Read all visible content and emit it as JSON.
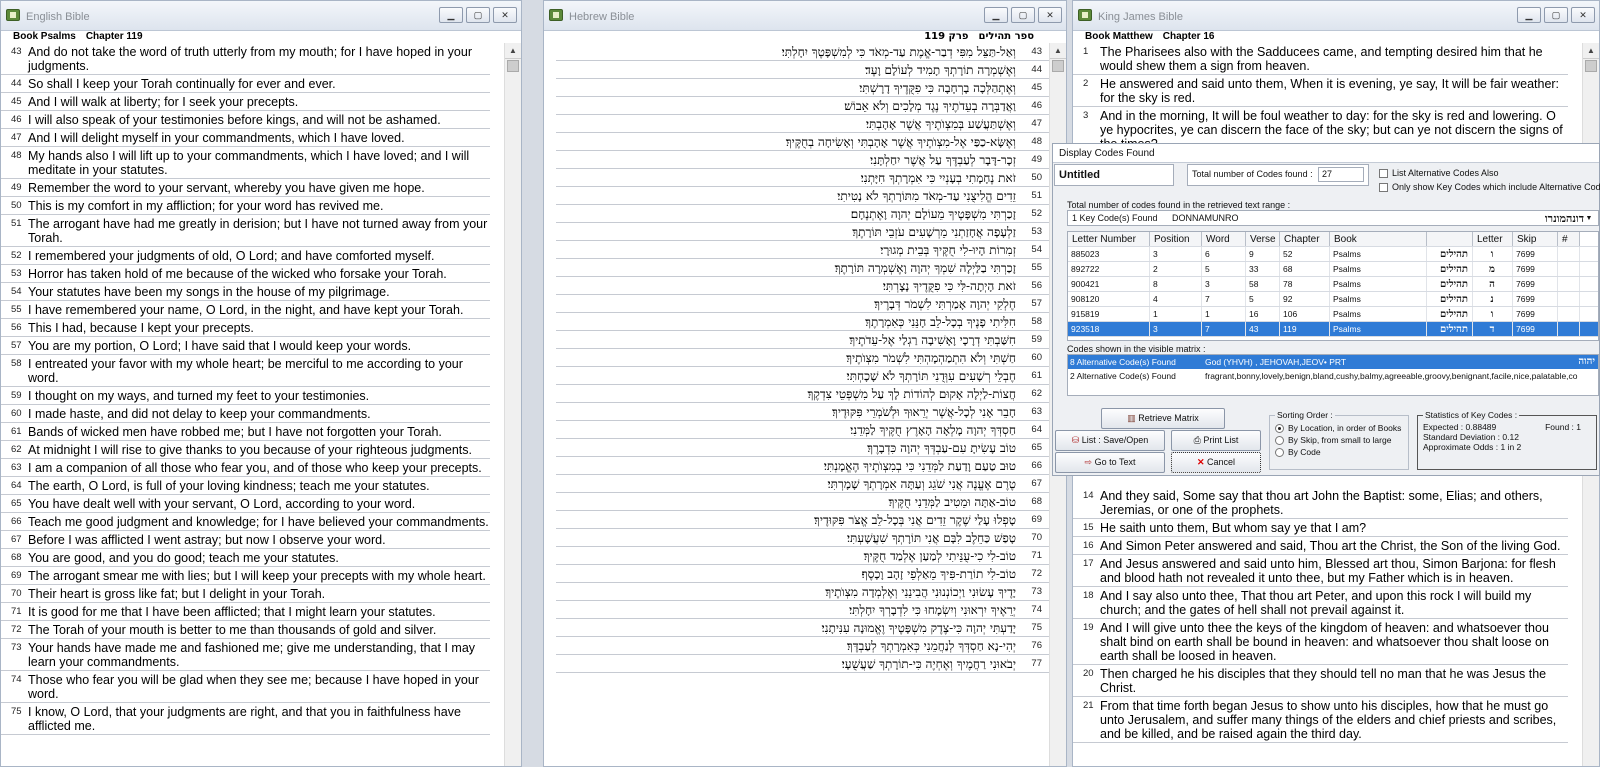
{
  "english": {
    "title": "English Bible",
    "book_label": "Book Psalms",
    "chapter_label": "Chapter 119",
    "rows": [
      {
        "n": "43",
        "t": "And do not take the word of truth utterly from my mouth; for I have hoped in your judgments."
      },
      {
        "n": "44",
        "t": "So shall I keep your Torah continually for ever and ever."
      },
      {
        "n": "45",
        "t": "And I will walk at liberty; for I seek your precepts."
      },
      {
        "n": "46",
        "t": "I will also speak of your testimonies before kings, and will not be ashamed."
      },
      {
        "n": "47",
        "t": "And I will delight myself in your commandments, which I have loved."
      },
      {
        "n": "48",
        "t": "My hands also I will lift up to your commandments, which I have loved; and I will meditate in your statutes."
      },
      {
        "n": "49",
        "t": "Remember the word to your servant, whereby you have given me hope."
      },
      {
        "n": "50",
        "t": "This is my comfort in my affliction; for your word has revived me."
      },
      {
        "n": "51",
        "t": "The arrogant have had me greatly in derision; but I have not turned away from your Torah."
      },
      {
        "n": "52",
        "t": "I remembered your judgments of old, O Lord; and have comforted myself."
      },
      {
        "n": "53",
        "t": "Horror has taken hold of me because of the wicked who forsake your Torah."
      },
      {
        "n": "54",
        "t": "Your statutes have been my songs in the house of my pilgrimage."
      },
      {
        "n": "55",
        "t": "I have remembered your name, O Lord, in the night, and have kept your Torah."
      },
      {
        "n": "56",
        "t": "This I had, because I kept your precepts."
      },
      {
        "n": "57",
        "t": "You are my portion, O Lord; I have said that I would keep your words."
      },
      {
        "n": "58",
        "t": "I entreated your favor with my whole heart; be merciful to me according to your word."
      },
      {
        "n": "59",
        "t": "I thought on my ways, and turned my feet to your testimonies."
      },
      {
        "n": "60",
        "t": "I made haste, and did not delay to keep your commandments."
      },
      {
        "n": "61",
        "t": "Bands of wicked men have robbed me; but I have not forgotten your Torah."
      },
      {
        "n": "62",
        "t": "At midnight I will rise to give thanks to you because of your righteous judgments."
      },
      {
        "n": "63",
        "t": "I am a companion of all those who fear you, and of those who keep your precepts."
      },
      {
        "n": "64",
        "t": "The earth, O Lord, is full of your loving kindness; teach me your statutes."
      },
      {
        "n": "65",
        "t": "You have dealt well with your servant, O Lord, according to your word."
      },
      {
        "n": "66",
        "t": "Teach me good judgment and knowledge; for I have believed your commandments."
      },
      {
        "n": "67",
        "t": "Before I was afflicted I went astray; but now I observe your word."
      },
      {
        "n": "68",
        "t": "You are good, and you do good; teach me your statutes."
      },
      {
        "n": "69",
        "t": "The arrogant smear me with lies; but I will keep your precepts with my whole heart."
      },
      {
        "n": "70",
        "t": "Their heart is gross like fat; but I delight in your Torah."
      },
      {
        "n": "71",
        "t": "It is good for me that I have been afflicted; that I might learn your statutes."
      },
      {
        "n": "72",
        "t": "The Torah of your mouth is better to me than thousands of gold and silver."
      },
      {
        "n": "73",
        "t": "Your hands have made me and fashioned me; give me understanding, that I may learn your commandments."
      },
      {
        "n": "74",
        "t": "Those who fear you will be glad when they see me; because I have hoped in your word."
      },
      {
        "n": "75",
        "t": "I know, O Lord, that your judgments are right, and that you in faithfulness have afflicted me."
      }
    ]
  },
  "hebrew": {
    "title": "Hebrew Bible",
    "book_label": "ספר תהילים",
    "chapter_label": "פרק 119",
    "rows": [
      {
        "n": "43",
        "t": "וְאַל-תַּצֵּל מִפִּי דְבַר-אֱמֶת עַד-מְאֹד כִּי לְמִשְׁפָּטֶךָ יִחָלְתִּי׃"
      },
      {
        "n": "44",
        "t": "וְאֶשְׁמְרָה תוֹרָתְךָ תָמִיד לְעוֹלָם וָעֶד׃"
      },
      {
        "n": "45",
        "t": "וְאֶתְהַלְּכָה בָרְחָבָה כִּי פִקֻּדֶיךָ דָרָשְׁתִּי׃"
      },
      {
        "n": "46",
        "t": "וַאֲדַבְּרָה בְעֵדֹתֶיךָ נֶגֶד מְלָכִים וְלֹא אֵבוֹשׁ׃"
      },
      {
        "n": "47",
        "t": "וְאֶשְׁתַּעֲשַׁע בְּמִצְוֺתֶיךָ אֲשֶׁר אָהָבְתִּי׃"
      },
      {
        "n": "48",
        "t": "וְאֶשָּׂא-כַפַּי אֶל-מִצְוֺתֶיךָ אֲשֶׁר אָהָבְתִּי וְאָשִׂיחָה בְחֻקֶּיךָ׃"
      },
      {
        "n": "49",
        "t": "זְכָר-דָּבָר לְעַבְדֶּךָ עַל אֲשֶׁר יִחַלְתָּנִי׃"
      },
      {
        "n": "50",
        "t": "זֹאת נֶחָמָתִי בְעָנְיִי כִּי אִמְרָתְךָ חִיָּתְנִי׃"
      },
      {
        "n": "51",
        "t": "זֵדִים הֱלִיצֻנִי עַד-מְאֹד מִתּוֹרָתְךָ לֹא נָטִיתִי׃"
      },
      {
        "n": "52",
        "t": "זָכַרְתִּי מִשְׁפָּטֶיךָ מֵעוֹלָם יְהוָה וָאֶתְנֶחָם׃"
      },
      {
        "n": "53",
        "t": "זַלְעָפָה אֲחָזַתְנִי מֵרְשָׁעִים עֹזְבֵי תּוֹרָתֶךָ׃"
      },
      {
        "n": "54",
        "t": "זְמִרוֹת הָיוּ-לִי חֻקֶּיךָ בְּבֵית מְגוּרָי׃"
      },
      {
        "n": "55",
        "t": "זָכַרְתִּי בַלַּיְלָה שִׁמְךָ יְהוָה וָאֶשְׁמְרָה תּוֹרָתֶךָ׃"
      },
      {
        "n": "56",
        "t": "זֹאת הָיְתָה-לִּי כִּי פִקֻּדֶיךָ נָצָרְתִּי׃"
      },
      {
        "n": "57",
        "t": "חֶלְקִי יְהוָה אָמַרְתִּי לִשְׁמֹר דְּבָרֶיךָ׃"
      },
      {
        "n": "58",
        "t": "חִלִּיתִי פָנֶיךָ בְכָל-לֵב חָנֵּנִי כְּאִמְרָתֶךָ׃"
      },
      {
        "n": "59",
        "t": "חִשַּׁבְתִּי דְרָכָי וָאָשִׁיבָה רַגְלַי אֶל-עֵדֹתֶיךָ׃"
      },
      {
        "n": "60",
        "t": "חַשְׁתִּי וְלֹא הִתְמַהְמָהְתִּי לִשְׁמֹר מִצְוֺתֶיךָ׃"
      },
      {
        "n": "61",
        "t": "חֶבְלֵי רְשָׁעִים עִוְּדֻנִי תּוֹרָתְךָ לֹא שָׁכָחְתִּי׃"
      },
      {
        "n": "62",
        "t": "חֲצוֹת-לַיְלָה אָקוּם לְהוֹדוֹת לָךְ עַל מִשְׁפְּטֵי צִדְקֶךָ׃"
      },
      {
        "n": "63",
        "t": "חָבֵר אָנִי לְכָל-אֲשֶׁר יְרֵאוּךָ וּלְשֹׁמְרֵי פִּקּוּדֶיךָ׃"
      },
      {
        "n": "64",
        "t": "חַסְדְּךָ יְהוָה מָלְאָה הָאָרֶץ חֻקֶּיךָ לַמְּדֵנִי׃"
      },
      {
        "n": "65",
        "t": "טוֹב עָשִׂיתָ עִם-עַבְדְּךָ יְהוָה כִּדְבָרֶךָ׃"
      },
      {
        "n": "66",
        "t": "טוּב טַעַם וָדַעַת לַמְּדֵנִי כִּי בְמִצְוֺתֶיךָ הֶאֱמָנְתִּי׃"
      },
      {
        "n": "67",
        "t": "טֶרֶם אֶעֱנֶה אֲנִי שֹׁגֵג וְעַתָּה אִמְרָתְךָ שָׁמָרְתִּי׃"
      },
      {
        "n": "68",
        "t": "טוֹב-אַתָּה וּמֵטִיב לַמְּדֵנִי חֻקֶּיךָ׃"
      },
      {
        "n": "69",
        "t": "טָפְלוּ עָלַי שֶׁקֶר זֵדִים אֲנִי בְּכָל-לֵב אֱצֹּר פִּקּוּדֶיךָ׃"
      },
      {
        "n": "70",
        "t": "טָפַשׁ כַּחֵלֶב לִבָּם אֲנִי תּוֹרָתְךָ שִׁעֲשָׁעְתִּי׃"
      },
      {
        "n": "71",
        "t": "טוֹב-לִי כִי-עֻנֵּיתִי לְמַעַן אֶלְמַד חֻקֶּיךָ׃"
      },
      {
        "n": "72",
        "t": "טוֹב-לִי תוֹרַת-פִּיךָ מֵאַלְפֵי זָהָב וָכָסֶף׃"
      },
      {
        "n": "73",
        "t": "יָדֶיךָ עָשׂוּנִי וַיְכוֹנְנוּנִי הֲבִינֵנִי וְאֶלְמְדָה מִצְוֺתֶיךָ׃"
      },
      {
        "n": "74",
        "t": "יְרֵאֶיךָ יִרְאוּנִי וְיִשְׂמָחוּ כִּי לִדְבָרְךָ יִחָלְתִּי׃"
      },
      {
        "n": "75",
        "t": "יָדַעְתִּי יְהוָה כִּי-צֶדֶק מִשְׁפָּטֶיךָ וֶאֱמוּנָה עִנִּיתָנִי׃"
      },
      {
        "n": "76",
        "t": "יְהִי-נָא חַסְדְּךָ לְנַחֲמֵנִי כְּאִמְרָתְךָ לְעַבְדֶּךָ׃"
      },
      {
        "n": "77",
        "t": "יְבֹאוּנִי רַחֲמֶיךָ וְאֶחְיֶה כִּי-תוֹרָתְךָ שַׁעֲשֻׁעָי׃"
      }
    ]
  },
  "kjv": {
    "title": "King James Bible",
    "book_label": "Book Matthew",
    "chapter_label": "Chapter 16",
    "rows_top": [
      {
        "n": "1",
        "t": "The Pharisees also with the Sadducees came, and tempting desired him that he would shew them a sign from heaven."
      },
      {
        "n": "2",
        "t": "He answered and said unto them, When it is evening, ye say, It will be fair weather: for the sky is red."
      },
      {
        "n": "3",
        "t": "And in the morning, It will be foul weather to day: for the sky is red and lowering. O ye hypocrites, ye can discern the face of the sky; but can ye not discern the signs of the times?"
      }
    ],
    "rows_bottom": [
      {
        "n": "14",
        "t": "And they said, Some say that thou art John the Baptist: some, Elias; and others, Jeremias, or one of the prophets."
      },
      {
        "n": "15",
        "t": "He saith unto them, But whom say ye that I am?"
      },
      {
        "n": "16",
        "t": "And Simon Peter answered and said, Thou art the Christ, the Son of the living God."
      },
      {
        "n": "17",
        "t": "And Jesus answered and said unto him, Blessed art thou, Simon Barjona: for flesh and blood hath not revealed it unto thee, but my Father which is in heaven."
      },
      {
        "n": "18",
        "t": "And I say also unto thee, That thou art Peter, and upon this rock I will build my church; and the gates of hell shall not prevail against it."
      },
      {
        "n": "19",
        "t": "And I will give unto thee the keys of the kingdom of heaven: and whatsoever thou shalt bind on earth shall be bound in heaven: and whatsoever thou shalt loose on earth shall be loosed in heaven."
      },
      {
        "n": "20",
        "t": "Then charged he his disciples that they should tell no man that he was Jesus the Christ."
      },
      {
        "n": "21",
        "t": "From that time forth began Jesus to show unto his disciples, how that he must go unto Jerusalem, and suffer many things of the elders and chief priests and scribes, and be killed, and be raised again the third day."
      }
    ]
  },
  "dialog": {
    "caption": "Display Codes Found",
    "name": "Untitled",
    "total_label": "Total number of Codes found :",
    "total_value": "27",
    "list_alt": "List Alternative Codes Also",
    "only_show": "Only show Key Codes which include Alternative Codes",
    "range_label": "Total number of codes found in the retrieved text range :",
    "key_found": "1 Key Code(s) Found",
    "key_name": "DONNAMUNRO",
    "key_heb": "דונהמונרו",
    "cols": [
      "Letter Number",
      "Position",
      "Word",
      "Verse",
      "Chapter",
      "Book",
      "",
      "Letter",
      "Skip",
      "#"
    ],
    "rows": [
      [
        "885023",
        "3",
        "6",
        "9",
        "52",
        "Psalms",
        "תהילים",
        "ו",
        "7699",
        ""
      ],
      [
        "892722",
        "2",
        "5",
        "33",
        "68",
        "Psalms",
        "תהילים",
        "מ",
        "7699",
        ""
      ],
      [
        "900421",
        "8",
        "3",
        "58",
        "78",
        "Psalms",
        "תהילים",
        "ה",
        "7699",
        ""
      ],
      [
        "908120",
        "4",
        "7",
        "5",
        "92",
        "Psalms",
        "תהילים",
        "נ",
        "7699",
        ""
      ],
      [
        "915819",
        "1",
        "1",
        "16",
        "106",
        "Psalms",
        "תהילים",
        "ו",
        "7699",
        ""
      ],
      [
        "923518",
        "3",
        "7",
        "43",
        "119",
        "Psalms",
        "תהילים",
        "ד",
        "7699",
        ""
      ]
    ],
    "visible_label": "Codes shown in the visible matrix :",
    "alt1_count": "8 Alternative Code(s) Found",
    "alt1_text": "God (YHVH) , JEHOVAH,JEOV• PRT",
    "alt1_heb": "יהוה",
    "alt2_count": "2 Alternative Code(s) Found",
    "alt2_text": "fragrant,bonny,lovely,benign,bland,cushy,balmy,agreeable,groovy,benignant,facile,nice,palatable,co",
    "btn_retrieve": "Retrieve Matrix",
    "btn_list": "List : Save/Open",
    "btn_print": "Print List",
    "btn_goto": "Go to Text",
    "btn_cancel": "Cancel",
    "sort_label": "Sorting Order :",
    "sort1": "By Location, in order of Books",
    "sort2": "By Skip, from small to large",
    "sort3": "By Code",
    "stats_label": "Statistics of Key Codes :",
    "expected": "Expected :   0.88489",
    "found": "Found :  1",
    "std": "Standard Deviation :      0.12",
    "odds": "Approximate Odds : 1 in 2"
  }
}
